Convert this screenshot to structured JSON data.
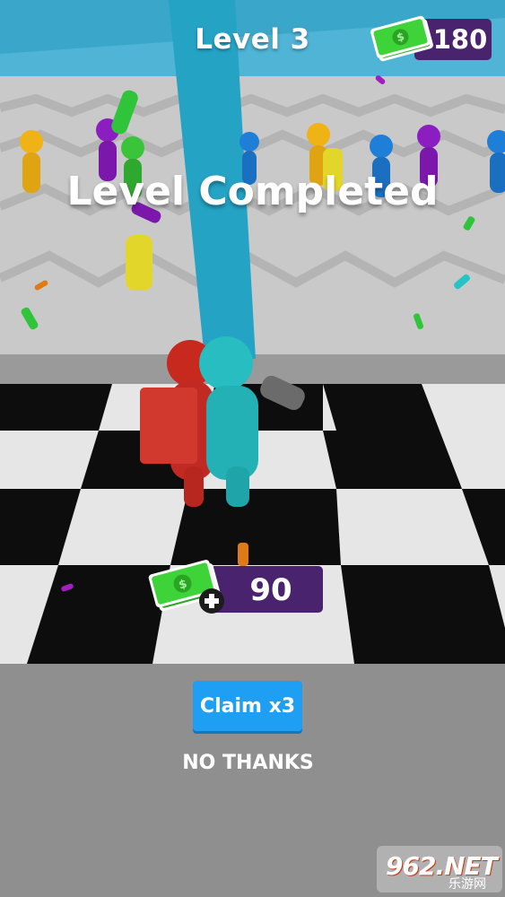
{
  "hud": {
    "level_label": "Level 3",
    "coins": "180",
    "coin_icon": "cash-stack-icon"
  },
  "result": {
    "headline": "Level Completed",
    "reward": "90",
    "reward_icon": "cash-plus-icon"
  },
  "actions": {
    "claim_label": "Claim x3",
    "decline_label": "NO THANKS"
  },
  "watermark": {
    "logo": "962.NET",
    "sub": "乐游网"
  },
  "colors": {
    "pill_bg": "#4a236e",
    "claim_button": "#1f9ff4",
    "cash_green": "#34c42c",
    "sky": "#3aa6c9",
    "floor_gray": "#8f8f8f"
  }
}
